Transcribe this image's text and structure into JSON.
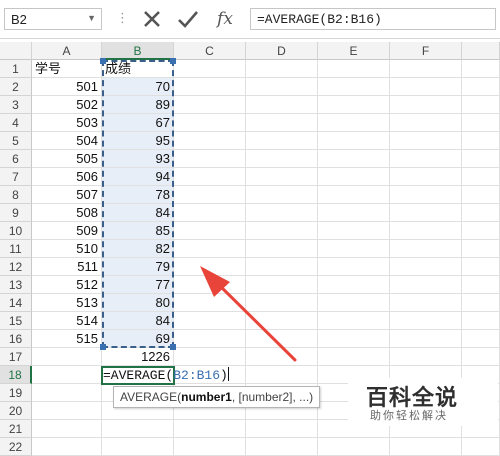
{
  "name_box": "B2",
  "formula_bar": {
    "formula": "=AVERAGE(B2:B16)"
  },
  "columns": [
    "A",
    "B",
    "C",
    "D",
    "E",
    "F"
  ],
  "rows": [
    "1",
    "2",
    "3",
    "4",
    "5",
    "6",
    "7",
    "8",
    "9",
    "10",
    "11",
    "12",
    "13",
    "14",
    "15",
    "16",
    "17",
    "18",
    "19",
    "20",
    "21",
    "22"
  ],
  "cells": {
    "A1": "学号",
    "B1": "成绩",
    "A": [
      "501",
      "502",
      "503",
      "504",
      "505",
      "506",
      "507",
      "508",
      "509",
      "510",
      "511",
      "512",
      "513",
      "514",
      "515"
    ],
    "B": [
      "70",
      "89",
      "67",
      "95",
      "93",
      "94",
      "78",
      "84",
      "85",
      "82",
      "79",
      "77",
      "80",
      "84",
      "69"
    ],
    "B17": "1226"
  },
  "editing_cell": {
    "prefix": "=AVERAGE(",
    "ref": "B2:B16",
    "suffix": ")"
  },
  "tooltip": {
    "func": "AVERAGE(",
    "arg1": "number1",
    "rest": ", [number2], ...)"
  },
  "watermark": {
    "title": "百科全说",
    "subtitle": "助你轻松解决"
  },
  "colors": {
    "selection_fill": "#e8eef8",
    "marquee": "#3a5f8a",
    "arrow": "#e8443a",
    "active_border": "#217346"
  }
}
